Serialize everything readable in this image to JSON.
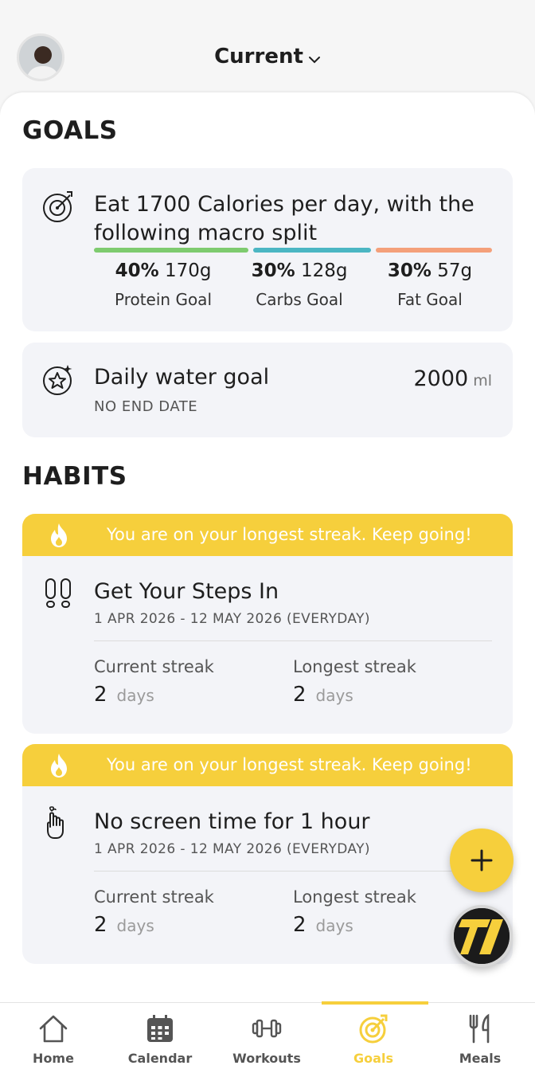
{
  "header": {
    "title": "Current",
    "avatar_icon": "user-avatar"
  },
  "goals": {
    "section_title": "GOALS",
    "nutrition": {
      "text_line1": "Eat 1700 Calories per day, with the",
      "text_line2": "following macro split",
      "macros": [
        {
          "percent": "40%",
          "grams": "170g",
          "label": "Protein Goal",
          "color": "#7ecb6f"
        },
        {
          "percent": "30%",
          "grams": "128g",
          "label": "Carbs Goal",
          "color": "#4bb6c3"
        },
        {
          "percent": "30%",
          "grams": "57g",
          "label": "Fat Goal",
          "color": "#f4a07a"
        }
      ]
    },
    "water": {
      "title": "Daily water goal",
      "subtitle": "NO END DATE",
      "value": "2000",
      "unit": "ml"
    }
  },
  "habits": {
    "section_title": "HABITS",
    "items": [
      {
        "banner": "You are on your longest streak. Keep going!",
        "title": "Get Your Steps In",
        "dates": "1 APR 2026 - 12 MAY 2026 (EVERYDAY)",
        "current_label": "Current streak",
        "current_value": "2",
        "longest_label": "Longest streak",
        "longest_value": "2",
        "days_unit": "days",
        "icon": "footprints-icon"
      },
      {
        "banner": "You are on your longest streak. Keep going!",
        "title": "No screen time for 1 hour",
        "dates": "1 APR 2026 - 12 MAY 2026 (EVERYDAY)",
        "current_label": "Current streak",
        "current_value": "2",
        "longest_label": "Longest streak",
        "longest_value": "2",
        "days_unit": "days",
        "icon": "hand-reminder-icon"
      }
    ]
  },
  "nav": {
    "items": [
      {
        "label": "Home",
        "icon": "home-icon"
      },
      {
        "label": "Calendar",
        "icon": "calendar-icon"
      },
      {
        "label": "Workouts",
        "icon": "dumbbell-icon"
      },
      {
        "label": "Goals",
        "icon": "target-icon",
        "active": true
      },
      {
        "label": "Meals",
        "icon": "fork-knife-icon"
      }
    ]
  },
  "colors": {
    "accent": "#f6cf3c",
    "card_bg": "#f3f4f8"
  }
}
